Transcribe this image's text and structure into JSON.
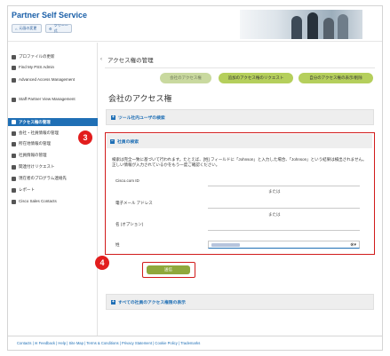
{
  "header": {
    "brand": "Partner Self Service",
    "home_label": "元画の変更",
    "tools_label": "ツリー一式"
  },
  "sidebar": {
    "items": [
      {
        "label": "プロファイルの更新",
        "icon": "person-icon"
      },
      {
        "label": "Find My PSS Admin",
        "icon": "search-icon"
      },
      {
        "label": "Advanced Access Management",
        "icon": "user-group-icon"
      },
      {
        "label": "Staff Partner View Management",
        "icon": "eye-icon"
      },
      {
        "label": "アクセス権の管理",
        "icon": "key-icon",
        "active": true
      },
      {
        "label": "会社・社員情報の管理",
        "icon": "building-icon"
      },
      {
        "label": "所在地情報の管理",
        "icon": "location-icon"
      },
      {
        "label": "社員情報の管理",
        "icon": "people-icon"
      },
      {
        "label": "関連付けリクエスト",
        "icon": "link-icon"
      },
      {
        "label": "現在者のプログラム連絡先",
        "icon": "contact-icon"
      },
      {
        "label": "レポート",
        "icon": "report-icon"
      },
      {
        "label": "Cisco Sales Contacts",
        "icon": "phone-icon"
      }
    ]
  },
  "main": {
    "collapse_glyph": "‹",
    "page_heading": "アクセス権の管理",
    "actions": {
      "company_access": "会社のアクセス権",
      "request_access": "追加のアクセス権のリクエスト",
      "view_own": "自分のアクセス権の表示/削除"
    },
    "title": "会社のアクセス権",
    "panels": {
      "tools_search": "ツール社内ユーザの検索",
      "employee_search": "社員の検索",
      "all_access": "すべての社員のアクセス権限の表示"
    },
    "search": {
      "note": "検索は完全一致に基づいて行われます。たとえば、[姓] フィールドに「Johnson」と入力した場合、「Johnson」という結果は検出されません。正しい情報が入力されているかをもう一度ご確認ください。",
      "fields": {
        "cco_label": "Cisco.com ID",
        "or1": "または",
        "email_label": "電子メール アドレス",
        "or2": "または",
        "firstname_label": "名 (オプション)",
        "lastname_label": "姓"
      },
      "submit_label": "送信"
    }
  },
  "callouts": {
    "step3": "3",
    "step4": "4"
  },
  "footer": {
    "text": "Contacts | ✉ Feedback | Help | Site Map | Terms & Conditions | Privacy Statement | Cookie Policy | Trademarks"
  },
  "colors": {
    "brand_blue": "#1f6fb5",
    "action_green": "#b5cf5c",
    "submit_green": "#8fa83c",
    "callout_red": "#e21d1d"
  }
}
